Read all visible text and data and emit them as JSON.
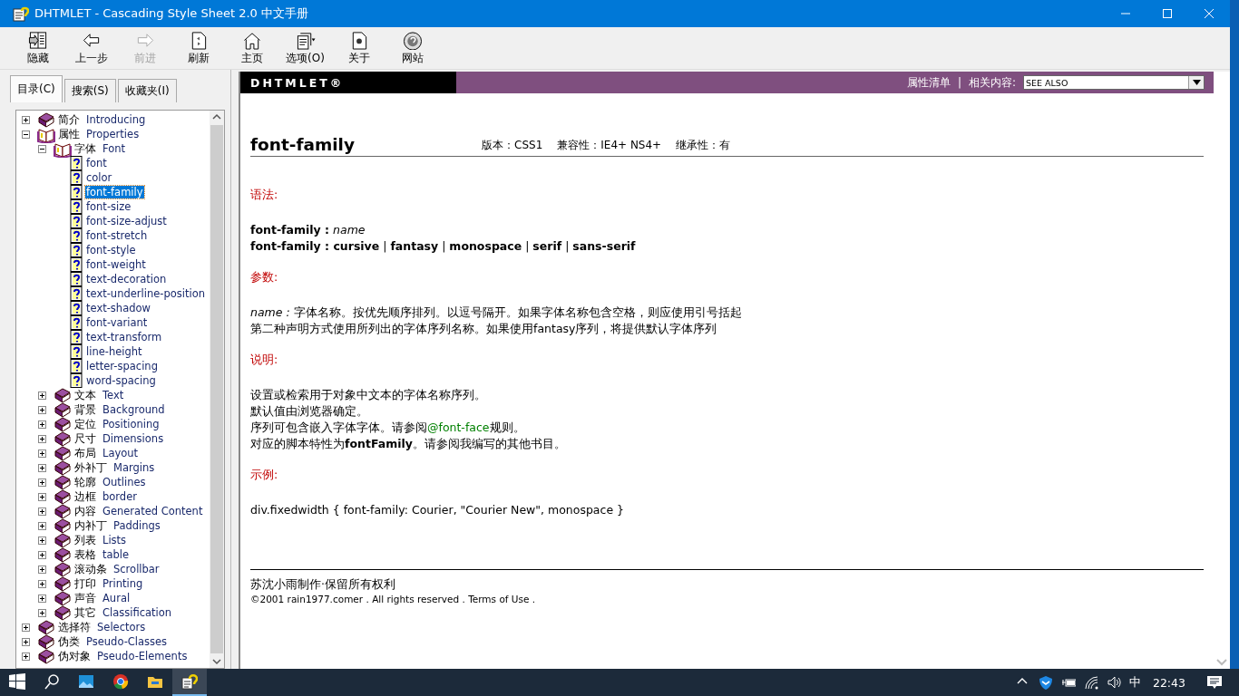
{
  "window": {
    "title": "DHTMLET - Cascading Style Sheet 2.0 中文手册"
  },
  "toolbar": [
    {
      "label": "隐藏",
      "disabled": false
    },
    {
      "label": "上一步",
      "disabled": false
    },
    {
      "label": "前进",
      "disabled": true
    },
    {
      "label": "刷新",
      "disabled": false
    },
    {
      "label": "主页",
      "disabled": false
    },
    {
      "label": "选项(O)",
      "disabled": false
    },
    {
      "label": "关于",
      "disabled": false
    },
    {
      "label": "网站",
      "disabled": false
    }
  ],
  "tabs": [
    {
      "label": "目录(C)",
      "selected": true
    },
    {
      "label": "搜索(S)",
      "selected": false
    },
    {
      "label": "收藏夹(I)",
      "selected": false
    }
  ],
  "tree": [
    {
      "kind": "book",
      "zh": "简介",
      "en": "Introducing",
      "expanded": false,
      "selected": false
    },
    {
      "kind": "book",
      "zh": "属性",
      "en": "Properties",
      "expanded": true,
      "selected": false,
      "children": [
        {
          "kind": "book",
          "zh": "字体",
          "en": "Font",
          "expanded": true,
          "selected": false,
          "children": [
            {
              "kind": "page",
              "en": "font",
              "selected": false
            },
            {
              "kind": "page",
              "en": "color",
              "selected": false
            },
            {
              "kind": "page",
              "en": "font-family",
              "selected": true
            },
            {
              "kind": "page",
              "en": "font-size",
              "selected": false
            },
            {
              "kind": "page",
              "en": "font-size-adjust",
              "selected": false
            },
            {
              "kind": "page",
              "en": "font-stretch",
              "selected": false
            },
            {
              "kind": "page",
              "en": "font-style",
              "selected": false
            },
            {
              "kind": "page",
              "en": "font-weight",
              "selected": false
            },
            {
              "kind": "page",
              "en": "text-decoration",
              "selected": false
            },
            {
              "kind": "page",
              "en": "text-underline-position",
              "selected": false
            },
            {
              "kind": "page",
              "en": "text-shadow",
              "selected": false
            },
            {
              "kind": "page",
              "en": "font-variant",
              "selected": false
            },
            {
              "kind": "page",
              "en": "text-transform",
              "selected": false
            },
            {
              "kind": "page",
              "en": "line-height",
              "selected": false
            },
            {
              "kind": "page",
              "en": "letter-spacing",
              "selected": false
            },
            {
              "kind": "page",
              "en": "word-spacing",
              "selected": false
            }
          ]
        },
        {
          "kind": "book",
          "zh": "文本",
          "en": "Text",
          "expanded": false,
          "selected": false
        },
        {
          "kind": "book",
          "zh": "背景",
          "en": "Background",
          "expanded": false,
          "selected": false
        },
        {
          "kind": "book",
          "zh": "定位",
          "en": "Positioning",
          "expanded": false,
          "selected": false
        },
        {
          "kind": "book",
          "zh": "尺寸",
          "en": "Dimensions",
          "expanded": false,
          "selected": false
        },
        {
          "kind": "book",
          "zh": "布局",
          "en": "Layout",
          "expanded": false,
          "selected": false
        },
        {
          "kind": "book",
          "zh": "外补丁",
          "en": "Margins",
          "expanded": false,
          "selected": false
        },
        {
          "kind": "book",
          "zh": "轮廓",
          "en": "Outlines",
          "expanded": false,
          "selected": false
        },
        {
          "kind": "book",
          "zh": "边框",
          "en": "border",
          "expanded": false,
          "selected": false
        },
        {
          "kind": "book",
          "zh": "内容",
          "en": "Generated Content",
          "expanded": false,
          "selected": false
        },
        {
          "kind": "book",
          "zh": "内补丁",
          "en": "Paddings",
          "expanded": false,
          "selected": false
        },
        {
          "kind": "book",
          "zh": "列表",
          "en": "Lists",
          "expanded": false,
          "selected": false
        },
        {
          "kind": "book",
          "zh": "表格",
          "en": "table",
          "expanded": false,
          "selected": false
        },
        {
          "kind": "book",
          "zh": "滚动条",
          "en": "Scrollbar",
          "expanded": false,
          "selected": false
        },
        {
          "kind": "book",
          "zh": "打印",
          "en": "Printing",
          "expanded": false,
          "selected": false
        },
        {
          "kind": "book",
          "zh": "声音",
          "en": "Aural",
          "expanded": false,
          "selected": false
        },
        {
          "kind": "book",
          "zh": "其它",
          "en": "Classification",
          "expanded": false,
          "selected": false
        }
      ]
    },
    {
      "kind": "book",
      "zh": "选择符",
      "en": "Selectors",
      "expanded": false,
      "selected": false
    },
    {
      "kind": "book",
      "zh": "伪类",
      "en": "Pseudo-Classes",
      "expanded": false,
      "selected": false
    },
    {
      "kind": "book",
      "zh": "伪对象",
      "en": "Pseudo-Elements",
      "expanded": false,
      "selected": false
    }
  ],
  "header": {
    "logo": "DHTMLET®",
    "links": [
      "属性清单",
      "|",
      "相关内容:"
    ],
    "dropdown": {
      "value": "SEE ALSO"
    }
  },
  "article": {
    "title": "font-family",
    "meta": [
      "版本：CSS1",
      "兼容性：IE4+ NS4+",
      "继承性：有"
    ],
    "sections": [
      {
        "heading": "语法:",
        "lines": [
          {
            "text": "**font-family :** *name*"
          },
          {
            "text": "**font-family : cursive** | **fantasy** | **monospace** | **serif** | **sans-serif**"
          }
        ]
      },
      {
        "heading": "参数:",
        "lines": [
          {
            "text": "*name :* 字体名称。按优先顺序排列。以逗号隔开。如果字体名称包含空格，则应使用引号括起"
          },
          {
            "text": "第二种声明方式使用所列出的字体序列名称。如果使用fantasy序列，将提供默认字体序列"
          }
        ]
      },
      {
        "heading": "说明:",
        "lines": [
          {
            "text": "设置或检索用于对象中文本的字体名称序列。"
          },
          {
            "text": "默认值由浏览器确定。"
          },
          {
            "parts": [
              {
                "kind": "text",
                "text": "序列可包含嵌入字体字体。请参阅"
              },
              {
                "kind": "link",
                "text": "@font-face"
              },
              {
                "kind": "text",
                "text": "规则。"
              }
            ]
          },
          {
            "text": "对应的脚本特性为**fontFamily**。请参阅我编写的其他书目。"
          }
        ]
      },
      {
        "heading": "示例:",
        "lines": [
          {
            "text": "div.fixedwidth { font-family: Courier, \"Courier New\", monospace }"
          }
        ]
      }
    ],
    "footer": [
      "苏沈小雨制作·保留所有权利",
      "©2001 rain1977.comer . All rights reserved . Terms of Use ."
    ]
  },
  "taskbar": {
    "apps": [
      {
        "active": false
      },
      {
        "active": false
      },
      {
        "active": false
      },
      {
        "active": false
      },
      {
        "active": true
      }
    ],
    "ime": "中",
    "clock": "22:43"
  }
}
